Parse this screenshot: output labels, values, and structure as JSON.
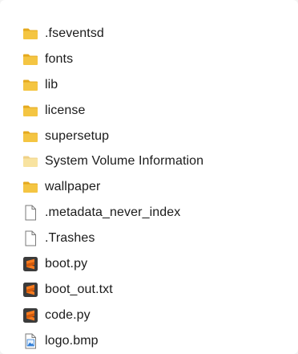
{
  "explorer": {
    "items": [
      {
        "name": ".fseventsd",
        "icon": "folder-icon"
      },
      {
        "name": "fonts",
        "icon": "folder-icon"
      },
      {
        "name": "lib",
        "icon": "folder-icon"
      },
      {
        "name": "license",
        "icon": "folder-icon"
      },
      {
        "name": "supersetup",
        "icon": "folder-icon"
      },
      {
        "name": "System Volume Information",
        "icon": "folder-hidden-icon"
      },
      {
        "name": "wallpaper",
        "icon": "folder-icon"
      },
      {
        "name": ".metadata_never_index",
        "icon": "blank-file-icon"
      },
      {
        "name": ".Trashes",
        "icon": "blank-file-icon"
      },
      {
        "name": "boot.py",
        "icon": "sublime-text-icon"
      },
      {
        "name": "boot_out.txt",
        "icon": "sublime-text-icon"
      },
      {
        "name": "code.py",
        "icon": "sublime-text-icon"
      },
      {
        "name": "logo.bmp",
        "icon": "bitmap-image-icon"
      }
    ]
  },
  "colors": {
    "folder": "#f4c542",
    "folder_tab": "#e5a91d",
    "folder_hidden": "#f8e3a0",
    "sublime": "#f97b1e",
    "sublime_bg": "#3b3b3b",
    "bitmap": "#2b7bd6"
  }
}
